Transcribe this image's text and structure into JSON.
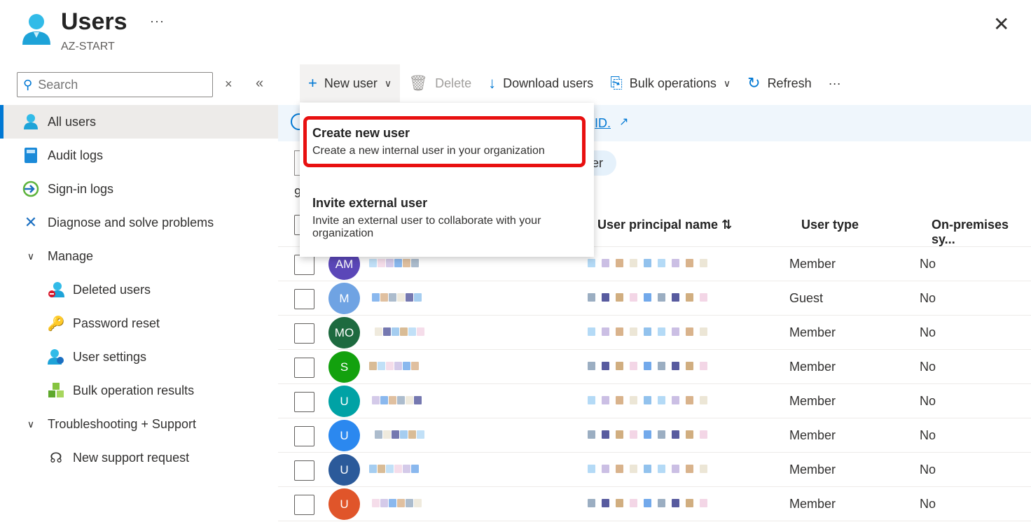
{
  "header": {
    "title": "Users",
    "subtitle": "AZ-START",
    "more": "···",
    "close": "✕"
  },
  "sidebar": {
    "search_placeholder": "Search",
    "items": [
      {
        "label": "All users",
        "icon": "user-icon",
        "active": true
      },
      {
        "label": "Audit logs",
        "icon": "book-icon"
      },
      {
        "label": "Sign-in logs",
        "icon": "sign-in-icon"
      },
      {
        "label": "Diagnose and solve problems",
        "icon": "wrench-icon"
      },
      {
        "label": "Manage",
        "icon": "chevron-down-icon",
        "group": true
      },
      {
        "label": "Deleted users",
        "icon": "deleted-user-icon",
        "sub": true
      },
      {
        "label": "Password reset",
        "icon": "key-icon",
        "sub": true
      },
      {
        "label": "User settings",
        "icon": "user-settings-icon",
        "sub": true
      },
      {
        "label": "Bulk operation results",
        "icon": "cubes-icon",
        "sub": true
      },
      {
        "label": "Troubleshooting + Support",
        "icon": "chevron-down-icon",
        "group": true
      },
      {
        "label": "New support request",
        "icon": "support-icon",
        "sub": true
      }
    ]
  },
  "toolbar": {
    "new_user": "New user",
    "delete": "Delete",
    "download": "Download users",
    "bulk": "Bulk operations",
    "refresh": "Refresh",
    "more": "···"
  },
  "banner": {
    "link_tail": "ID."
  },
  "filter_tail": "er",
  "count_partial": "9",
  "dropdown": {
    "items": [
      {
        "title": "Create new user",
        "desc": "Create a new internal user in your organization"
      },
      {
        "title": "Invite external user",
        "desc": "Invite an external user to collaborate with your organization"
      }
    ]
  },
  "table": {
    "columns": {
      "upn": "User principal name ⇅",
      "type": "User type",
      "onprem": "On-premises sy..."
    },
    "rows": [
      {
        "initials": "AM",
        "color": "#5b47b8",
        "type": "Member",
        "onprem": "No"
      },
      {
        "initials": "M",
        "color": "#6fa3e3",
        "type": "Guest",
        "onprem": "No"
      },
      {
        "initials": "MO",
        "color": "#1d6a3f",
        "type": "Member",
        "onprem": "No"
      },
      {
        "initials": "S",
        "color": "#13a10e",
        "type": "Member",
        "onprem": "No"
      },
      {
        "initials": "U",
        "color": "#00a2a5",
        "type": "Member",
        "onprem": "No"
      },
      {
        "initials": "U",
        "color": "#2b88ef",
        "type": "Member",
        "onprem": "No"
      },
      {
        "initials": "U",
        "color": "#2b5a9a",
        "type": "Member",
        "onprem": "No"
      },
      {
        "initials": "U",
        "color": "#e0552a",
        "type": "Member",
        "onprem": "No"
      }
    ]
  },
  "colors": {
    "accent": "#0078d4",
    "highlight": "#e81010"
  }
}
